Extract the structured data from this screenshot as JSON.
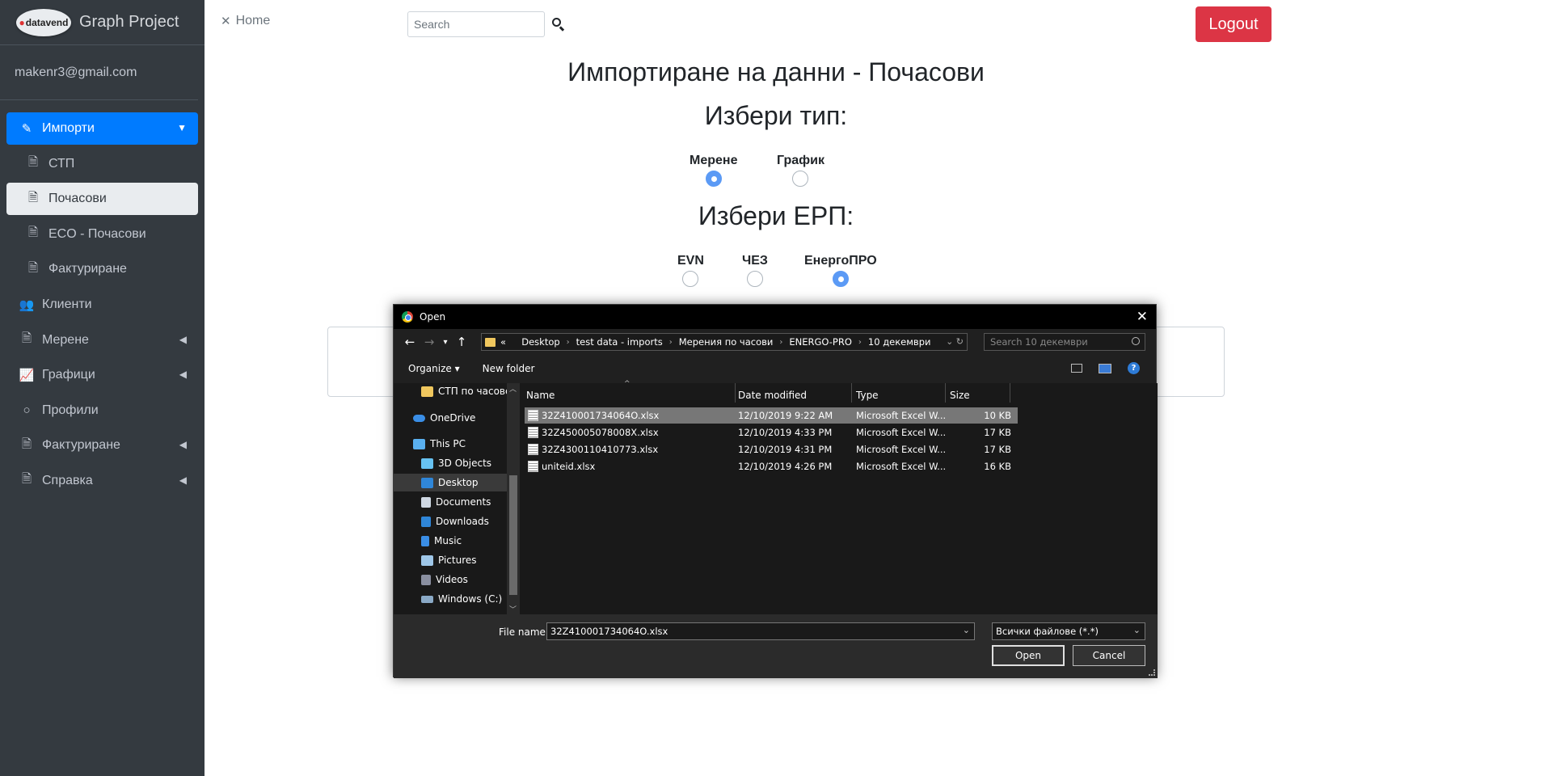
{
  "brand": {
    "logo_text": "datavend",
    "title": "Graph Project"
  },
  "user": {
    "email": "makenr3@gmail.com"
  },
  "sidebar": {
    "items": [
      {
        "label": "Импорти"
      },
      {
        "label": "СТП"
      },
      {
        "label": "Почасови"
      },
      {
        "label": "ECO - Почасови"
      },
      {
        "label": "Фактуриране"
      },
      {
        "label": "Клиенти"
      },
      {
        "label": "Мерене"
      },
      {
        "label": "Графици"
      },
      {
        "label": "Профили"
      },
      {
        "label": "Фактуриране"
      },
      {
        "label": "Справка"
      }
    ]
  },
  "topnav": {
    "home_label": "Home",
    "search_placeholder": "Search",
    "logout_label": "Logout"
  },
  "main": {
    "title": "Импортиране на данни - Почасови",
    "type_heading": "Избери тип:",
    "type_options": [
      {
        "label": "Мерене",
        "checked": true
      },
      {
        "label": "График",
        "checked": false
      }
    ],
    "erp_heading": "Избери ЕРП:",
    "erp_options": [
      {
        "label": "EVN",
        "checked": false
      },
      {
        "label": "ЧЕЗ",
        "checked": false
      },
      {
        "label": "ЕнергоПРО",
        "checked": true
      }
    ]
  },
  "dialog": {
    "title": "Open",
    "path_prefix": "«",
    "breadcrumbs": [
      "Desktop",
      "test data - imports",
      "Мерения по часови",
      "ENERGO-PRO",
      "10 декември"
    ],
    "search_placeholder": "Search 10 декември",
    "organize_label": "Organize ▾",
    "new_folder_label": "New folder",
    "help_label": "?",
    "tree": [
      {
        "label": "СТП по часове",
        "icon": "folder-icon"
      },
      {
        "label": "OneDrive",
        "icon": "cloud-icon"
      },
      {
        "label": "This PC",
        "icon": "pc-icon"
      },
      {
        "label": "3D Objects",
        "icon": "cube-icon"
      },
      {
        "label": "Desktop",
        "icon": "desktop-icon"
      },
      {
        "label": "Documents",
        "icon": "document-icon"
      },
      {
        "label": "Downloads",
        "icon": "download-icon"
      },
      {
        "label": "Music",
        "icon": "music-icon"
      },
      {
        "label": "Pictures",
        "icon": "picture-icon"
      },
      {
        "label": "Videos",
        "icon": "video-icon"
      },
      {
        "label": "Windows (C:)",
        "icon": "drive-icon"
      }
    ],
    "columns": {
      "name": "Name",
      "date": "Date modified",
      "type": "Type",
      "size": "Size"
    },
    "files": [
      {
        "name": "32Z410001734064O.xlsx",
        "date": "12/10/2019 9:22 AM",
        "type": "Microsoft Excel W...",
        "size": "10 KB"
      },
      {
        "name": "32Z450005078008X.xlsx",
        "date": "12/10/2019 4:33 PM",
        "type": "Microsoft Excel W...",
        "size": "17 KB"
      },
      {
        "name": "32Z430011041077З.xlsx",
        "date": "12/10/2019 4:31 PM",
        "type": "Microsoft Excel W...",
        "size": "17 KB"
      },
      {
        "name": "uniteid.xlsx",
        "date": "12/10/2019 4:26 PM",
        "type": "Microsoft Excel W...",
        "size": "16 KB"
      }
    ],
    "file_name_label": "File name:",
    "file_name_value": "32Z410001734064O.xlsx",
    "file_type_value": "Всички файлове (*.*)",
    "open_label": "Open",
    "cancel_label": "Cancel"
  },
  "colors": {
    "sidebar_bg": "#343a40",
    "primary": "#007bff",
    "danger": "#dc3545",
    "radio_checked": "#5b9af5",
    "dialog_bg": "#202020"
  }
}
